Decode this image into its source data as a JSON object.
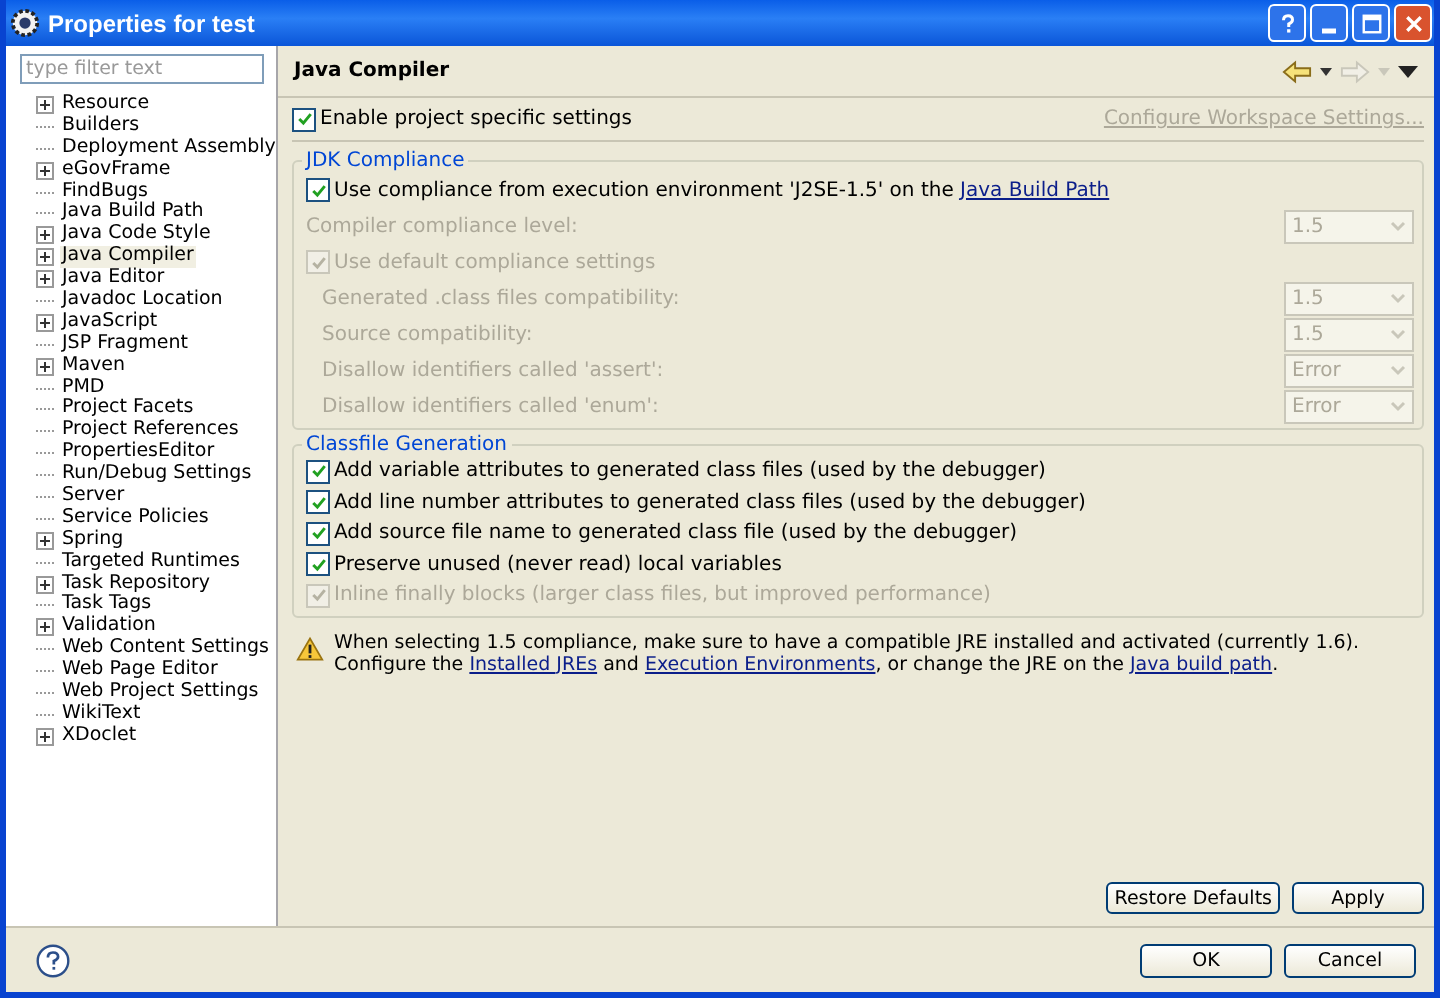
{
  "window": {
    "title": "Properties for test"
  },
  "filter": {
    "placeholder": "type filter text"
  },
  "tree": [
    {
      "label": "Resource",
      "expandable": true,
      "selected": false
    },
    {
      "label": "Builders",
      "expandable": false,
      "selected": false
    },
    {
      "label": "Deployment Assembly",
      "expandable": false,
      "selected": false
    },
    {
      "label": "eGovFrame",
      "expandable": true,
      "selected": false
    },
    {
      "label": "FindBugs",
      "expandable": false,
      "selected": false
    },
    {
      "label": "Java Build Path",
      "expandable": false,
      "selected": false
    },
    {
      "label": "Java Code Style",
      "expandable": true,
      "selected": false
    },
    {
      "label": "Java Compiler",
      "expandable": true,
      "selected": true
    },
    {
      "label": "Java Editor",
      "expandable": true,
      "selected": false
    },
    {
      "label": "Javadoc Location",
      "expandable": false,
      "selected": false
    },
    {
      "label": "JavaScript",
      "expandable": true,
      "selected": false
    },
    {
      "label": "JSP Fragment",
      "expandable": false,
      "selected": false
    },
    {
      "label": "Maven",
      "expandable": true,
      "selected": false
    },
    {
      "label": "PMD",
      "expandable": false,
      "selected": false
    },
    {
      "label": "Project Facets",
      "expandable": false,
      "selected": false
    },
    {
      "label": "Project References",
      "expandable": false,
      "selected": false
    },
    {
      "label": "PropertiesEditor",
      "expandable": false,
      "selected": false
    },
    {
      "label": "Run/Debug Settings",
      "expandable": false,
      "selected": false
    },
    {
      "label": "Server",
      "expandable": false,
      "selected": false
    },
    {
      "label": "Service Policies",
      "expandable": false,
      "selected": false
    },
    {
      "label": "Spring",
      "expandable": true,
      "selected": false
    },
    {
      "label": "Targeted Runtimes",
      "expandable": false,
      "selected": false
    },
    {
      "label": "Task Repository",
      "expandable": true,
      "selected": false
    },
    {
      "label": "Task Tags",
      "expandable": false,
      "selected": false
    },
    {
      "label": "Validation",
      "expandable": true,
      "selected": false
    },
    {
      "label": "Web Content Settings",
      "expandable": false,
      "selected": false
    },
    {
      "label": "Web Page Editor",
      "expandable": false,
      "selected": false
    },
    {
      "label": "Web Project Settings",
      "expandable": false,
      "selected": false
    },
    {
      "label": "WikiText",
      "expandable": false,
      "selected": false
    },
    {
      "label": "XDoclet",
      "expandable": true,
      "selected": false
    }
  ],
  "page": {
    "title": "Java Compiler",
    "nav": {
      "back_disabled": false,
      "forward_disabled": true
    },
    "enable_specific": {
      "label": "Enable project specific settings",
      "checked": true
    },
    "configure_link": {
      "label": "Configure Workspace Settings...",
      "disabled": true
    }
  },
  "jdk_compliance": {
    "title": "JDK Compliance",
    "use_ee": {
      "checked": true,
      "disabled": false,
      "segments": [
        {
          "kind": "text",
          "text": "Use compliance from execution environment 'J2SE-1.5' on the "
        },
        {
          "kind": "link",
          "text": "Java Build Path"
        }
      ]
    },
    "compliance_level": {
      "label": "Compiler compliance level:",
      "value": "1.5",
      "disabled": true
    },
    "use_default": {
      "label": "Use default compliance settings",
      "checked": true,
      "disabled": true,
      "children": [
        {
          "label": "Generated .class files compatibility:",
          "value": "1.5",
          "disabled": true
        },
        {
          "label": "Source compatibility:",
          "value": "1.5",
          "disabled": true
        },
        {
          "label": "Disallow identifiers called 'assert':",
          "value": "Error",
          "disabled": true
        },
        {
          "label": "Disallow identifiers called 'enum':",
          "value": "Error",
          "disabled": true
        }
      ]
    }
  },
  "classfile": {
    "title": "Classfile Generation",
    "options": [
      {
        "label": "Add variable attributes to generated class files (used by the debugger)",
        "checked": true,
        "disabled": false
      },
      {
        "label": "Add line number attributes to generated class files (used by the debugger)",
        "checked": true,
        "disabled": false
      },
      {
        "label": "Add source file name to generated class file (used by the debugger)",
        "checked": true,
        "disabled": false
      },
      {
        "label": "Preserve unused (never read) local variables",
        "checked": true,
        "disabled": false
      },
      {
        "label": "Inline finally blocks (larger class files, but improved performance)",
        "checked": true,
        "disabled": true
      }
    ]
  },
  "warning": {
    "segments": [
      {
        "kind": "text",
        "text": "When selecting 1.5 compliance, make sure to have a compatible JRE installed and activated (currently 1.6). Configure the "
      },
      {
        "kind": "link",
        "text": "Installed JREs"
      },
      {
        "kind": "text",
        "text": " and "
      },
      {
        "kind": "link",
        "text": "Execution Environments"
      },
      {
        "kind": "text",
        "text": ", or change the JRE on the "
      },
      {
        "kind": "link",
        "text": "Java build path"
      },
      {
        "kind": "text",
        "text": "."
      }
    ]
  },
  "page_buttons": [
    "Restore Defaults",
    "Apply"
  ],
  "dialog_buttons": [
    "OK",
    "Cancel"
  ]
}
